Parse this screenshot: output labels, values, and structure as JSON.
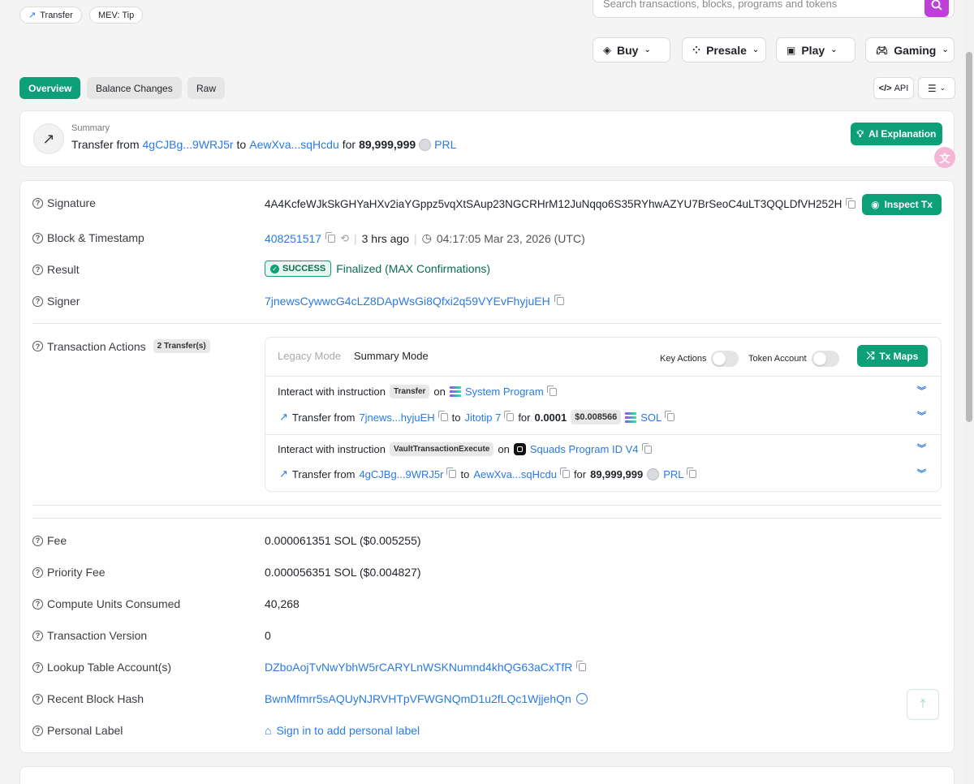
{
  "tags": {
    "transfer": "Transfer",
    "mev": "MEV: Tip"
  },
  "search": {
    "placeholder": "Search transactions, blocks, programs and tokens"
  },
  "menus": {
    "buy": "Buy",
    "presale": "Presale",
    "play": "Play",
    "gaming": "Gaming"
  },
  "tabs": {
    "overview": "Overview",
    "balance": "Balance Changes",
    "raw": "Raw"
  },
  "tools": {
    "api": "API"
  },
  "summary": {
    "label": "Summary",
    "prefix": "Transfer from",
    "from": "4gCJBg...9WRJ5r",
    "to_word": "to",
    "to": "AewXva...sqHcdu",
    "for_word": "for",
    "amount": "89,999,999",
    "token": "PRL",
    "ai_button": "AI Explanation"
  },
  "details": {
    "signature_label": "Signature",
    "signature": "4A4KcfeWJkSkGHYaHXv2iaYGppz5vqXtSAup23NGCRHrM12JuNqqo6S35RYhwAZYU7BrSeoC4uLT3QQLDfVH252H",
    "inspect_button": "Inspect Tx",
    "block_label": "Block & Timestamp",
    "block": "408251517",
    "ago": "3 hrs ago",
    "timestamp": "04:17:05 Mar 23, 2026 (UTC)",
    "result_label": "Result",
    "result_badge": "SUCCESS",
    "result_text": "Finalized (MAX Confirmations)",
    "signer_label": "Signer",
    "signer": "7jnewsCywwcG4cLZ8DApWsGi8Qfxi2q59VYEvFhyjuEH",
    "actions_label": "Transaction Actions",
    "actions_badge": "2 Transfer(s)"
  },
  "actions": {
    "legacy_mode": "Legacy Mode",
    "summary_mode": "Summary Mode",
    "key_actions": "Key Actions",
    "token_account": "Token Account",
    "tx_maps": "Tx Maps",
    "interact_prefix": "Interact with instruction",
    "on_word": "on",
    "transfer_from": "Transfer from",
    "to_word": "to",
    "for_word": "for",
    "ins1_name": "Transfer",
    "ins1_program": "System Program",
    "t1_from": "7jnews...hyjuEH",
    "t1_to": "Jitotip 7",
    "t1_amount": "0.0001",
    "t1_usd": "$0.008566",
    "t1_token": "SOL",
    "ins2_name": "VaultTransactionExecute",
    "ins2_program": "Squads Program ID V4",
    "t2_from": "4gCJBg...9WRJ5r",
    "t2_to": "AewXva...sqHcdu",
    "t2_amount": "89,999,999",
    "t2_token": "PRL"
  },
  "fees": {
    "fee_label": "Fee",
    "fee": "0.000061351 SOL ($0.005255)",
    "priority_label": "Priority Fee",
    "priority": "0.000056351 SOL ($0.004827)",
    "cu_label": "Compute Units Consumed",
    "cu": "40,268",
    "version_label": "Transaction Version",
    "version": "0",
    "lookup_label": "Lookup Table Account(s)",
    "lookup": "DZboAojTvNwYbhW5rCARYLnWSKNumnd4khQG63aCxTfR",
    "hash_label": "Recent Block Hash",
    "hash": "BwnMfmrr5sAQUyNJRVHTpVFWGNQmD1u2fLQc1WjjehQn",
    "personal_label": "Personal Label",
    "personal_link": "Sign in to add personal label"
  },
  "colors": {
    "accent": "#0d9f78",
    "link": "#2a7ae2",
    "search": "#c03ed9"
  }
}
